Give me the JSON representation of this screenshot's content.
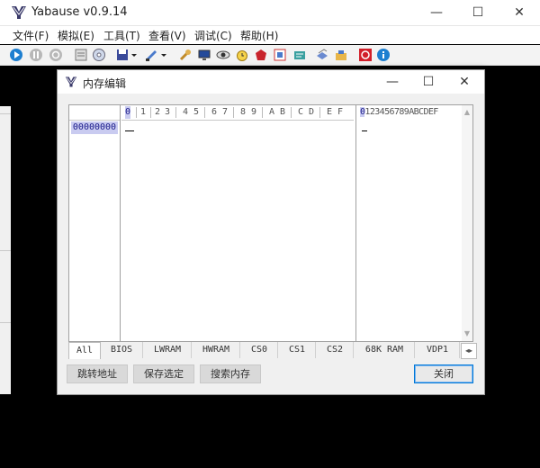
{
  "app": {
    "title": "Yabause v0.9.14",
    "window_controls": {
      "minimize": "—",
      "maximize": "☐",
      "close": "✕"
    }
  },
  "menu": [
    "文件(F)",
    "模拟(E)",
    "工具(T)",
    "查看(V)",
    "调试(C)",
    "帮助(H)"
  ],
  "toolbar_icons": [
    "play-icon",
    "pause-icon",
    "reset-icon",
    "open-iso-icon",
    "open-cd-icon",
    "save-state-icon",
    "dropdown-arrow-icon",
    "load-state-icon",
    "dropdown-arrow-icon",
    "settings-wrench-icon",
    "monitor-icon",
    "eye-icon",
    "alarm-clock-icon",
    "record-icon",
    "fullscreen-icon",
    "log-icon",
    "layers-icon",
    "tools-icon",
    "stop-power-icon",
    "about-icon"
  ],
  "dialog": {
    "title": "内存编辑",
    "window_controls": {
      "minimize": "—",
      "maximize": "☐",
      "close": "✕"
    },
    "address": "00000000",
    "hex_header": [
      "0",
      "1",
      "2",
      "3",
      "4",
      "5",
      "6",
      "7",
      "8",
      "9",
      "A",
      "B",
      "C",
      "D",
      "E",
      "F"
    ],
    "ascii_header_first": "0",
    "ascii_header_rest": "123456789ABCDEF",
    "tabs": [
      "All",
      "BIOS",
      "LWRAM",
      "HWRAM",
      "CS0",
      "CS1",
      "CS2",
      "68K RAM",
      "VDP1"
    ],
    "tab_arrows": "◂▸",
    "buttons": {
      "goto": "跳转地址",
      "save_selection": "保存选定",
      "search_memory": "搜索内存",
      "close": "关闭"
    }
  }
}
